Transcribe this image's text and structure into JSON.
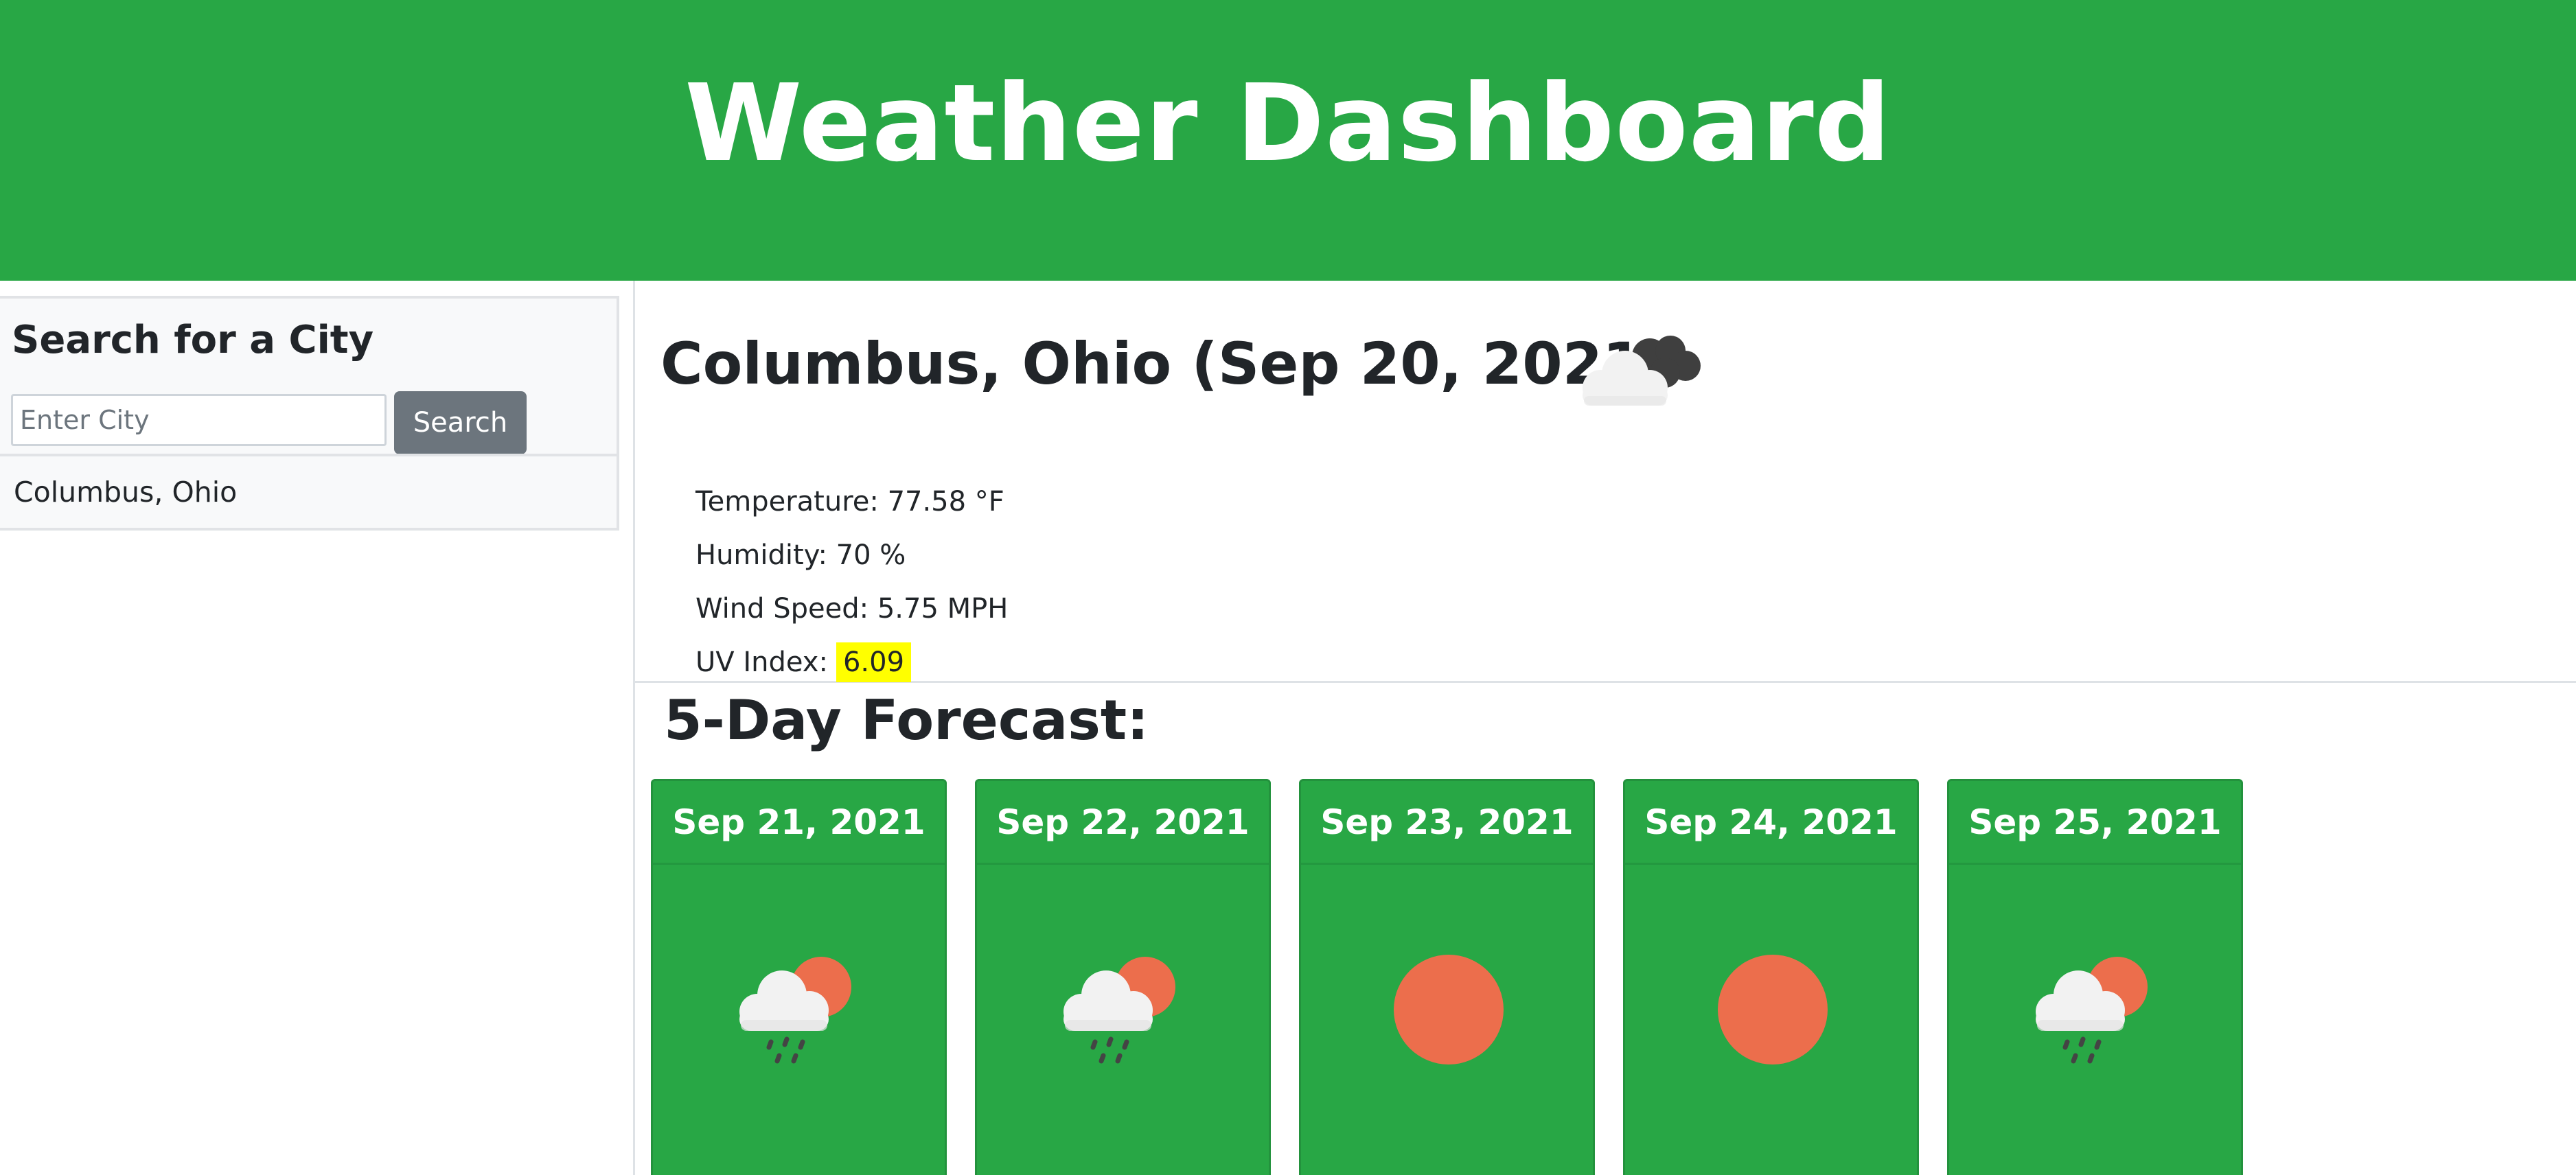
{
  "header": {
    "title": "Weather Dashboard"
  },
  "colors": {
    "brand_green": "#28a745",
    "uv_highlight": "#ffff00",
    "button_gray": "#6c757d"
  },
  "search": {
    "heading": "Search for a City",
    "placeholder": "Enter City",
    "value": "",
    "button_label": "Search"
  },
  "history": [
    {
      "label": "Columbus, Ohio"
    }
  ],
  "current": {
    "title": "Columbus, Ohio (Sep 20, 2021)",
    "icon": "partly-cloudy-dark-icon",
    "temperature": "Temperature: 77.58 °F",
    "humidity": "Humidity: 70 %",
    "wind": "Wind Speed: 5.75 MPH",
    "uv_label": "UV Index:",
    "uv_value": "6.09"
  },
  "forecast": {
    "heading": "5-Day Forecast:",
    "days": [
      {
        "date": "Sep 21, 2021",
        "icon": "rain-sun-icon"
      },
      {
        "date": "Sep 22, 2021",
        "icon": "rain-sun-icon"
      },
      {
        "date": "Sep 23, 2021",
        "icon": "sun-icon"
      },
      {
        "date": "Sep 24, 2021",
        "icon": "sun-icon"
      },
      {
        "date": "Sep 25, 2021",
        "icon": "rain-sun-icon"
      }
    ]
  }
}
